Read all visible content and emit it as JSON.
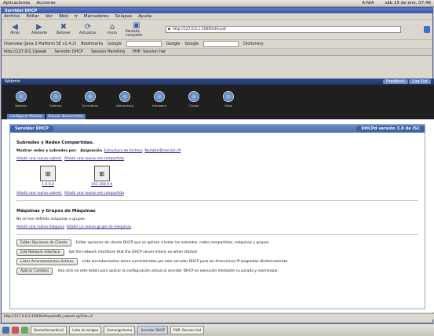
{
  "panel": {
    "menus": [
      "Aplicaciones",
      "Acciones"
    ],
    "right": [
      "A:N/A",
      "sáb 15 de ene, 07:46"
    ]
  },
  "window": {
    "title": "Servidor DHCP"
  },
  "menubar": [
    "Archivo",
    "Editar",
    "Ver",
    "Web",
    "Ir",
    "Marcadores",
    "Solapas",
    "Ayuda"
  ],
  "nav": {
    "buttons": [
      {
        "icon": "◀",
        "label": "Atrás"
      },
      {
        "icon": "▶",
        "label": "Adelante"
      },
      {
        "icon": "✖",
        "label": "Detener"
      },
      {
        "icon": "⟳",
        "label": "Actualizar"
      },
      {
        "icon": "⌂",
        "label": "Inicio"
      },
      {
        "icon": "▣",
        "label": "Pantalla completa"
      }
    ],
    "url": "http://127.0.0.1:10000/dhcpd/"
  },
  "bookmarks": [
    "Overview (Java 2 Platform SE v1.4.2)",
    "Bookmarks",
    "Google",
    "Google",
    "Google",
    "Dictionary"
  ],
  "tabs": [
    "http://127.0.0.1/pwab",
    "Servidor DHCP",
    "Session Handling",
    "PHP: Session hat"
  ],
  "webmin": {
    "topbar_left": "Webmin",
    "feedback": "Feedback",
    "logout": "Log Out",
    "categories": [
      "Webmin",
      "Sistema",
      "Servidores",
      "Networking",
      "Hardware",
      "Cluster",
      "Otros"
    ],
    "module_tabs": [
      "Configurar Módulo",
      "Buscar documentos"
    ]
  },
  "content": {
    "title": "Servidor DHCP",
    "version": "DHCPd versión 3.8 de ISC",
    "section1_title": "Subredes y Redes Compartidas.",
    "show_label": "Mostrar redes y subredes por:",
    "show_opt1": "Asignación",
    "show_opt2": "Estructura de Archivo",
    "show_opt3": "Nombre/Dirección IP",
    "add_subnet": "Añadir una nueva subred.",
    "add_shared": "Añadir una nueva red compartida",
    "nets": [
      "1.0.0.0",
      "192.168.0.0"
    ],
    "section2_title": "Máquinas y Grupos de Máquinas",
    "no_hosts": "No se han definido máquinas o grupos.",
    "add_host": "Añadir una nueva máquina",
    "add_group": "Añadir un nuevo grupo de máquinas",
    "buttons": [
      {
        "label": "Editar Opciones de Cliente",
        "desc": "Editar opciones de cliente DHCP que se aplican a todas las subredes, redes compartidas, máquinas y grupos."
      },
      {
        "label": "Edit Network Interface",
        "desc": "Set the network interfaces that the DHCP server listens on when started."
      },
      {
        "label": "Listar Arrendamientos Activos",
        "desc": "Lista arrendamientos ahora suministrados por este servidor DHCP para las direcciones IP asignadas dinámicamente."
      },
      {
        "label": "Aplicar Cambios",
        "desc": "Haz click en este botón para aplicar la configuración actual al servidor DHCP en ejecución mediante su parada y rearranque."
      }
    ]
  },
  "status": "http://127.0.0.1:10000/dhcpd/edit_subnet.cgi?idx=2",
  "taskbar": [
    "[home/lemachine]",
    "Lista de amigos",
    "[lemar@chema",
    "Servidor DHCP",
    "PHP: Session hat"
  ],
  "colors": {
    "accent": "#4c6fad",
    "link": "#22228a"
  }
}
